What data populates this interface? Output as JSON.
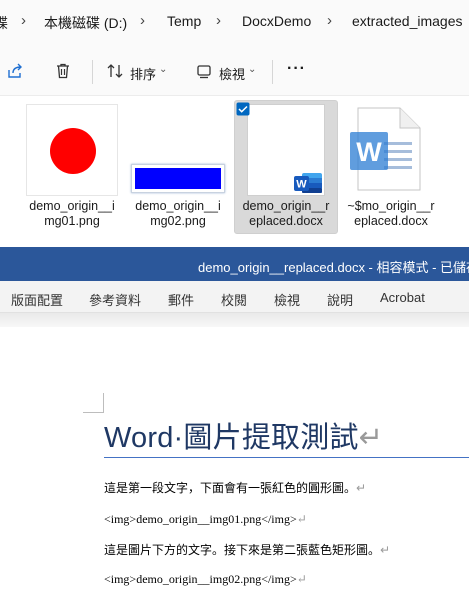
{
  "explorer": {
    "breadcrumb": {
      "partial_left": "碟",
      "items": [
        "本機磁碟 (D:)",
        "Temp",
        "DocxDemo",
        "extracted_images"
      ],
      "separator": ">"
    },
    "toolbar": {
      "sort_label": "排序",
      "view_label": "檢視",
      "more_label": "···"
    },
    "files": [
      {
        "name_line1": "demo_origin__i",
        "name_line2": "mg01.png",
        "type": "png-red-circle"
      },
      {
        "name_line1": "demo_origin__i",
        "name_line2": "mg02.png",
        "type": "png-blue-rect"
      },
      {
        "name_line1": "demo_origin__r",
        "name_line2": "eplaced.docx",
        "type": "docx",
        "selected": true
      },
      {
        "name_line1": "~$mo_origin__r",
        "name_line2": "eplaced.docx",
        "type": "docx-temp"
      }
    ]
  },
  "word": {
    "title": "demo_origin__replaced.docx  -  相容模式  -  已儲存",
    "ribbon_tabs": [
      "版面配置",
      "參考資料",
      "郵件",
      "校閱",
      "檢視",
      "說明",
      "Acrobat"
    ],
    "doc_icon_letter": "W",
    "document": {
      "heading": "Word·圖片提取測試",
      "paragraphs": [
        "這是第一段文字，下面會有一張紅色的圓形圖。",
        "<img>demo_origin__img01.png</img>",
        "這是圖片下方的文字。接下來是第二張藍色矩形圖。",
        "<img>demo_origin__img02.png</img>"
      ],
      "paragraph_mark": "↵"
    }
  },
  "colors": {
    "word_blue": "#2b579a",
    "heading_color": "#1f3864",
    "red_circle": "#ff0000",
    "blue_rect": "#0000ff",
    "selection_check": "#0067c0"
  }
}
